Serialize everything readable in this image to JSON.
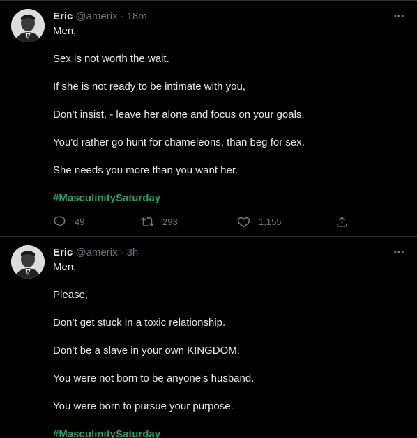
{
  "colors": {
    "background": "#000000",
    "text": "#e7e9ea",
    "muted": "#71767b",
    "hashtag": "#1ea362",
    "divider": "#2f3336"
  },
  "tweets": [
    {
      "author": {
        "name": "Eric",
        "handle": "@amerix"
      },
      "separator": "·",
      "time": "18m",
      "lines": [
        "Men,",
        "Sex is not worth the wait.",
        "If she is not ready to be intimate with you,",
        "Don't insist, - leave her alone and focus on your goals.",
        "You'd rather go hunt for chameleons, than beg for sex.",
        "She needs you more than you want her."
      ],
      "hashtag": "#MasculinitySaturday",
      "stats": {
        "replies": "49",
        "retweets": "293",
        "likes": "1,155"
      },
      "icons": {
        "more": "more-icon",
        "reply": "reply-icon",
        "retweet": "retweet-icon",
        "like": "heart-icon",
        "share": "share-icon"
      }
    },
    {
      "author": {
        "name": "Eric",
        "handle": "@amerix"
      },
      "separator": "·",
      "time": "3h",
      "lines": [
        "Men,",
        "Please,",
        "Don't get stuck in a toxic relationship.",
        "Don't be a slave in your own KINGDOM.",
        "You were not born to be anyone's husband.",
        "You were born to pursue your purpose."
      ],
      "hashtag": "#MasculinitySaturday"
    }
  ]
}
